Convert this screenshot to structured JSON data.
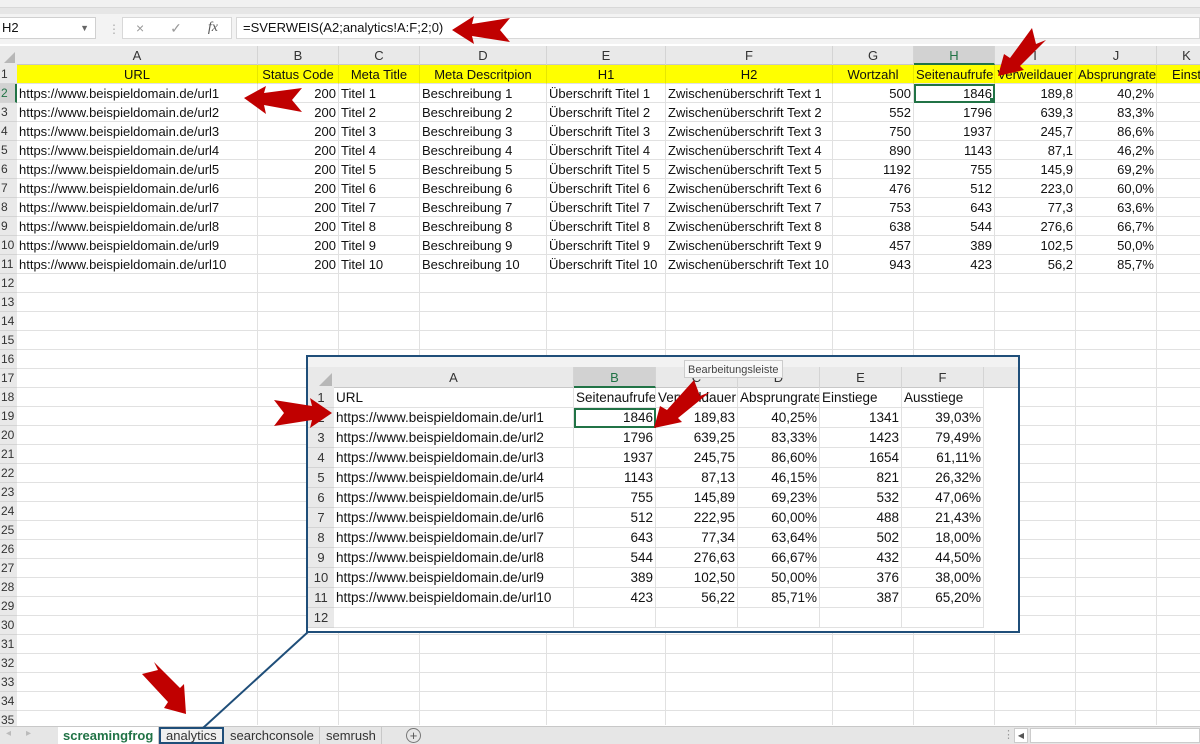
{
  "formula_bar": {
    "name_box": "H2",
    "cancel_icon": "×",
    "confirm_icon": "✓",
    "fx_label": "fx",
    "formula": "=SVERWEIS(A2;analytics!A:F;2;0)"
  },
  "main_sheet": {
    "column_letters": [
      "A",
      "B",
      "C",
      "D",
      "E",
      "F",
      "G",
      "H",
      "I",
      "J",
      "K"
    ],
    "selected_column": "H",
    "selected_row": 2,
    "headers": [
      "URL",
      "Status Code",
      "Meta Title",
      "Meta Descritpion",
      "H1",
      "H2",
      "Wortzahl",
      "Seitenaufrufe",
      "Verweildauer",
      "Absprungrate",
      "Einst"
    ],
    "rows": [
      [
        "https://www.beispieldomain.de/url1",
        "200",
        "Titel 1",
        "Beschreibung 1",
        "Überschrift Titel 1",
        "Zwischenüberschrift Text 1",
        "500",
        "1846",
        "189,8",
        "40,2%",
        ""
      ],
      [
        "https://www.beispieldomain.de/url2",
        "200",
        "Titel 2",
        "Beschreibung 2",
        "Überschrift Titel 2",
        "Zwischenüberschrift Text 2",
        "552",
        "1796",
        "639,3",
        "83,3%",
        ""
      ],
      [
        "https://www.beispieldomain.de/url3",
        "200",
        "Titel 3",
        "Beschreibung 3",
        "Überschrift Titel 3",
        "Zwischenüberschrift Text 3",
        "750",
        "1937",
        "245,7",
        "86,6%",
        ""
      ],
      [
        "https://www.beispieldomain.de/url4",
        "200",
        "Titel 4",
        "Beschreibung 4",
        "Überschrift Titel 4",
        "Zwischenüberschrift Text 4",
        "890",
        "1143",
        "87,1",
        "46,2%",
        ""
      ],
      [
        "https://www.beispieldomain.de/url5",
        "200",
        "Titel 5",
        "Beschreibung 5",
        "Überschrift Titel 5",
        "Zwischenüberschrift Text 5",
        "1192",
        "755",
        "145,9",
        "69,2%",
        ""
      ],
      [
        "https://www.beispieldomain.de/url6",
        "200",
        "Titel 6",
        "Beschreibung 6",
        "Überschrift Titel 6",
        "Zwischenüberschrift Text 6",
        "476",
        "512",
        "223,0",
        "60,0%",
        ""
      ],
      [
        "https://www.beispieldomain.de/url7",
        "200",
        "Titel 7",
        "Beschreibung 7",
        "Überschrift Titel 7",
        "Zwischenüberschrift Text 7",
        "753",
        "643",
        "77,3",
        "63,6%",
        ""
      ],
      [
        "https://www.beispieldomain.de/url8",
        "200",
        "Titel 8",
        "Beschreibung 8",
        "Überschrift Titel 8",
        "Zwischenüberschrift Text 8",
        "638",
        "544",
        "276,6",
        "66,7%",
        ""
      ],
      [
        "https://www.beispieldomain.de/url9",
        "200",
        "Titel 9",
        "Beschreibung 9",
        "Überschrift Titel 9",
        "Zwischenüberschrift Text 9",
        "457",
        "389",
        "102,5",
        "50,0%",
        ""
      ],
      [
        "https://www.beispieldomain.de/url10",
        "200",
        "Titel 10",
        "Beschreibung 10",
        "Überschrift Titel 10",
        "Zwischenüberschrift Text 10",
        "943",
        "423",
        "56,2",
        "85,7%",
        ""
      ]
    ],
    "row_numbers": [
      "1",
      "2",
      "3",
      "4",
      "5",
      "6",
      "7",
      "8",
      "9",
      "10",
      "11",
      "12",
      "13",
      "14",
      "15",
      "16",
      "17",
      "18",
      "19",
      "20",
      "21",
      "22",
      "23",
      "24",
      "25",
      "26",
      "27",
      "28",
      "29",
      "30",
      "31",
      "32",
      "33",
      "34",
      "35"
    ]
  },
  "analytics_popup": {
    "tooltip": "Bearbeitungsleiste",
    "column_letters": [
      "A",
      "B",
      "C",
      "D",
      "E",
      "F"
    ],
    "selected_column": "B",
    "headers": [
      "URL",
      "Seitenaufrufe",
      "Verweildauer",
      "Absprungrate",
      "Einstiege",
      "Ausstiege"
    ],
    "rows": [
      [
        "https://www.beispieldomain.de/url1",
        "1846",
        "189,83",
        "40,25%",
        "1341",
        "39,03%"
      ],
      [
        "https://www.beispieldomain.de/url2",
        "1796",
        "639,25",
        "83,33%",
        "1423",
        "79,49%"
      ],
      [
        "https://www.beispieldomain.de/url3",
        "1937",
        "245,75",
        "86,60%",
        "1654",
        "61,11%"
      ],
      [
        "https://www.beispieldomain.de/url4",
        "1143",
        "87,13",
        "46,15%",
        "821",
        "26,32%"
      ],
      [
        "https://www.beispieldomain.de/url5",
        "755",
        "145,89",
        "69,23%",
        "532",
        "47,06%"
      ],
      [
        "https://www.beispieldomain.de/url6",
        "512",
        "222,95",
        "60,00%",
        "488",
        "21,43%"
      ],
      [
        "https://www.beispieldomain.de/url7",
        "643",
        "77,34",
        "63,64%",
        "502",
        "18,00%"
      ],
      [
        "https://www.beispieldomain.de/url8",
        "544",
        "276,63",
        "66,67%",
        "432",
        "44,50%"
      ],
      [
        "https://www.beispieldomain.de/url9",
        "389",
        "102,50",
        "50,00%",
        "376",
        "38,00%"
      ],
      [
        "https://www.beispieldomain.de/url10",
        "423",
        "56,22",
        "85,71%",
        "387",
        "65,20%"
      ]
    ],
    "row_numbers": [
      "1",
      "2",
      "3",
      "4",
      "5",
      "6",
      "7",
      "8",
      "9",
      "10",
      "11",
      "12"
    ]
  },
  "sheet_tabs": {
    "tabs": [
      "screamingfrog",
      "analytics",
      "searchconsole",
      "semrush"
    ],
    "active": "screamingfrog",
    "highlighted": "analytics",
    "add_label": "+",
    "prev_icon": "◂",
    "next_icon": "▸"
  },
  "colors": {
    "header_fill": "#ffff00",
    "selection_green": "#217346",
    "popup_border": "#1f4e79",
    "arrow_red": "#c00000"
  }
}
